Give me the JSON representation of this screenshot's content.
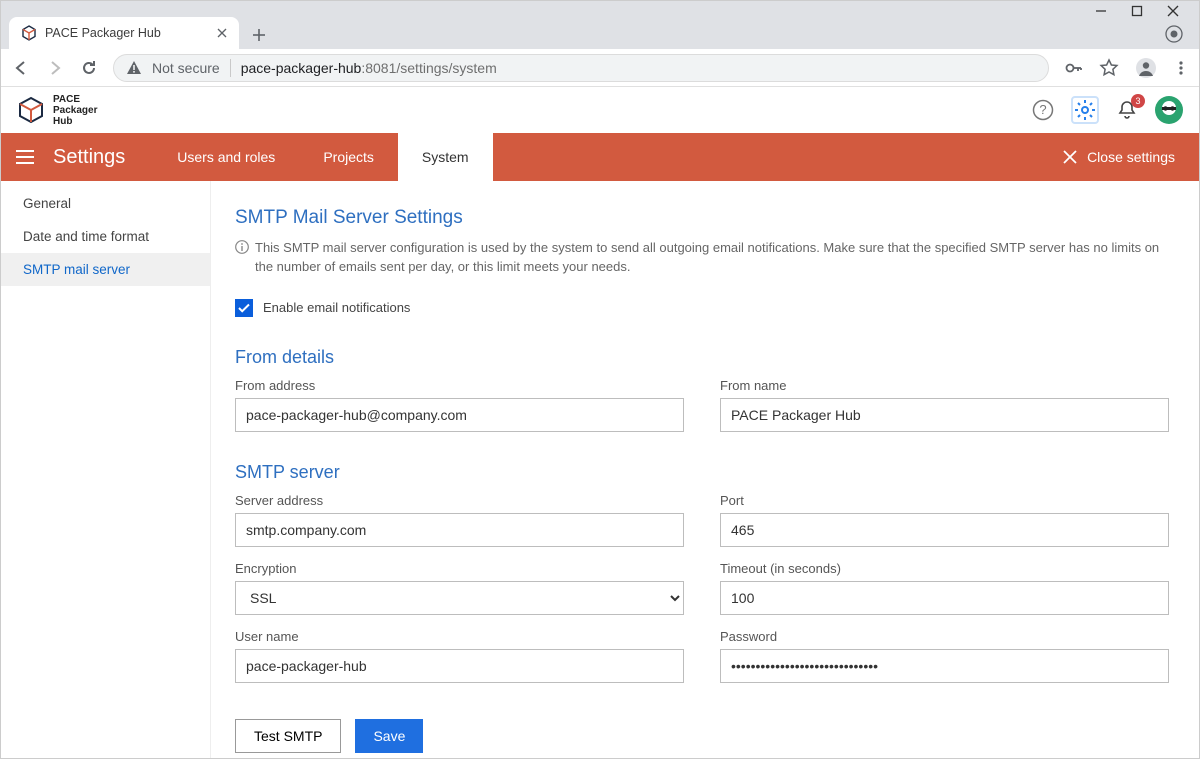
{
  "browser": {
    "tab_title": "PACE Packager Hub",
    "url_security_label": "Not secure",
    "url_host": "pace-packager-hub",
    "url_port_path": ":8081/settings/system"
  },
  "brand": {
    "line1": "PACE",
    "line2": "Packager",
    "line3": "Hub"
  },
  "notif_count": "3",
  "settings_bar": {
    "title": "Settings",
    "tabs": {
      "users": "Users and roles",
      "projects": "Projects",
      "system": "System"
    },
    "close": "Close settings"
  },
  "sidebar": {
    "general": "General",
    "datetime": "Date and time format",
    "smtp": "SMTP mail server"
  },
  "page": {
    "title": "SMTP Mail Server Settings",
    "info": "This SMTP mail server configuration is used by the system to send all outgoing email notifications. Make sure that the specified SMTP server has no limits on the number of emails sent per day, or this limit meets your needs.",
    "enable_label": "Enable email notifications",
    "from_heading": "From details",
    "from_address_label": "From address",
    "from_address_value": "pace-packager-hub@company.com",
    "from_name_label": "From name",
    "from_name_value": "PACE Packager Hub",
    "smtp_heading": "SMTP server",
    "server_label": "Server address",
    "server_value": "smtp.company.com",
    "port_label": "Port",
    "port_value": "465",
    "enc_label": "Encryption",
    "enc_value": "SSL",
    "timeout_label": "Timeout (in seconds)",
    "timeout_value": "100",
    "user_label": "User name",
    "user_value": "pace-packager-hub",
    "pass_label": "Password",
    "pass_value": "••••••••••••••••••••••••••••••",
    "btn_test": "Test SMTP",
    "btn_save": "Save"
  }
}
